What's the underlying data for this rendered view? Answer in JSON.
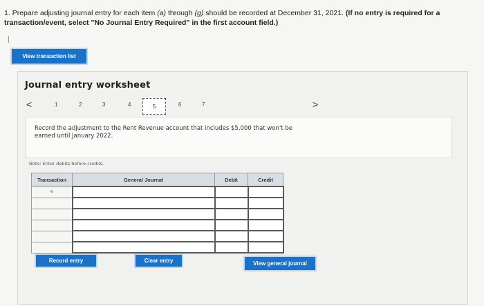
{
  "question": {
    "number": "1.",
    "text_part1": "Prepare adjusting journal entry for each item ",
    "item_a": "(a)",
    "text_part2": " through ",
    "item_g": "(g)",
    "text_part3": " should be recorded at December 31, 2021. ",
    "instruction": "(If no entry is required for a transaction/event, select \"No Journal Entry Required\" in the first account field.)"
  },
  "buttons": {
    "view_transactions": "View transaction list",
    "record_entry": "Record entry",
    "clear_entry": "Clear entry",
    "view_general_journal": "View general journal"
  },
  "worksheet": {
    "title": "Journal entry worksheet",
    "pages": [
      "1",
      "2",
      "3",
      "4",
      "5",
      "6",
      "7"
    ],
    "current_page": "5",
    "prev_arrow": "<",
    "next_arrow": ">",
    "description": "Record the adjustment to the Rent Revenue account that includes $5,000 that won't be earned until January 2022.",
    "note": "Note: Enter debits before credits."
  },
  "table": {
    "headers": {
      "transaction": "Transaction",
      "general_journal": "General Journal",
      "debit": "Debit",
      "credit": "Credit"
    },
    "first_transaction": "e"
  }
}
